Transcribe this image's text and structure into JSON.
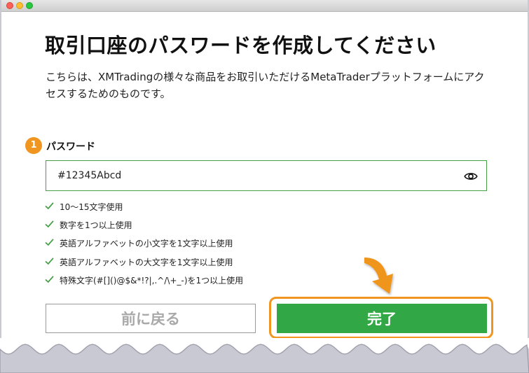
{
  "page": {
    "title": "取引口座のパスワードを作成してください",
    "description": "こちらは、XMTradingの様々な商品をお取引いただけるMetaTraderプラットフォームにアクセスするためのものです。"
  },
  "password_field": {
    "step": "1",
    "label": "パスワード",
    "value": "#12345Abcd"
  },
  "rules": [
    "10〜15文字使用",
    "数字を1つ以上使用",
    "英語アルファベットの小文字を1文字以上使用",
    "英語アルファベットの大文字を1文字以上使用",
    "特殊文字(#[]()@$&*!?|,.^/\\+_-)を1つ以上使用"
  ],
  "buttons": {
    "back": "前に戻る",
    "done": "完了"
  },
  "colors": {
    "accent_orange": "#f0951f",
    "success_green": "#31a845",
    "check_green": "#46a046"
  }
}
